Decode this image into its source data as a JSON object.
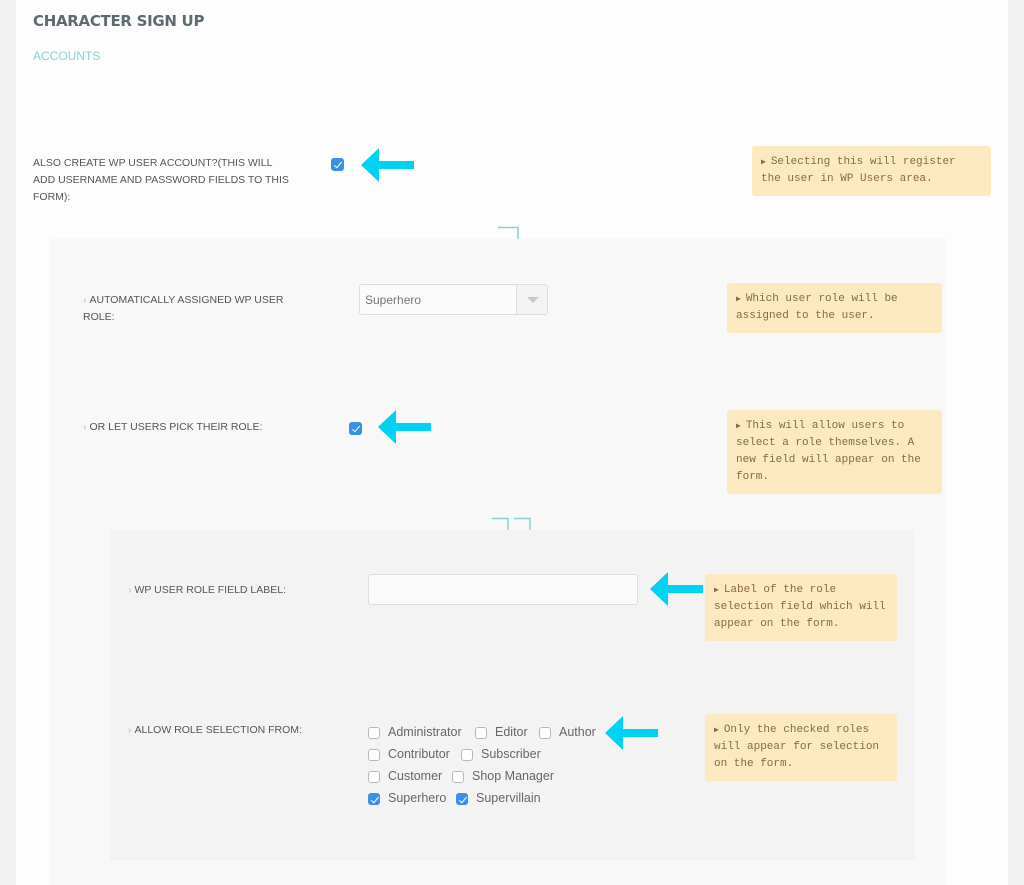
{
  "header": {
    "title": "CHARACTER SIGN UP",
    "section": "ACCOUNTS"
  },
  "colors": {
    "accent": "#8ccfd1",
    "arrow": "#00d2f2",
    "tip_bg": "#fde9bf",
    "tip_text": "#8a6a3e",
    "checkbox": "#3c8fe6"
  },
  "fields": {
    "create_wp_user": {
      "label": "ALSO CREATE WP USER ACCOUNT?(THIS WILL ADD USERNAME AND PASSWORD FIELDS TO THIS FORM):",
      "checked": true,
      "tip": "Selecting this will register the user in WP Users area."
    },
    "auto_role": {
      "label": "AUTOMATICALLY ASSIGNED WP USER ROLE:",
      "value": "Superhero",
      "tip": "Which user role will be assigned to the user."
    },
    "let_pick": {
      "label": "OR LET USERS PICK THEIR ROLE:",
      "checked": true,
      "tip": "This will allow users to select a role themselves. A new field will appear on the form."
    },
    "role_field_label": {
      "label": "WP USER ROLE FIELD LABEL:",
      "value": "",
      "placeholder": "",
      "tip": "Label of the role selection field which will appear on the form."
    },
    "allow_roles": {
      "label": "ALLOW ROLE SELECTION FROM:",
      "tip": "Only the checked roles will appear for selection on the form.",
      "roles": [
        {
          "name": "Administrator",
          "checked": false
        },
        {
          "name": "Editor",
          "checked": false
        },
        {
          "name": "Author",
          "checked": false
        },
        {
          "name": "Contributor",
          "checked": false
        },
        {
          "name": "Subscriber",
          "checked": false
        },
        {
          "name": "Customer",
          "checked": false
        },
        {
          "name": "Shop Manager",
          "checked": false
        },
        {
          "name": "Superhero",
          "checked": true
        },
        {
          "name": "Supervillain",
          "checked": true
        }
      ]
    }
  },
  "icons": {
    "chevron": "›",
    "tip_marker": "▶",
    "arrow": "left-arrow-icon",
    "connector": "down-arrow-connector-icon"
  }
}
